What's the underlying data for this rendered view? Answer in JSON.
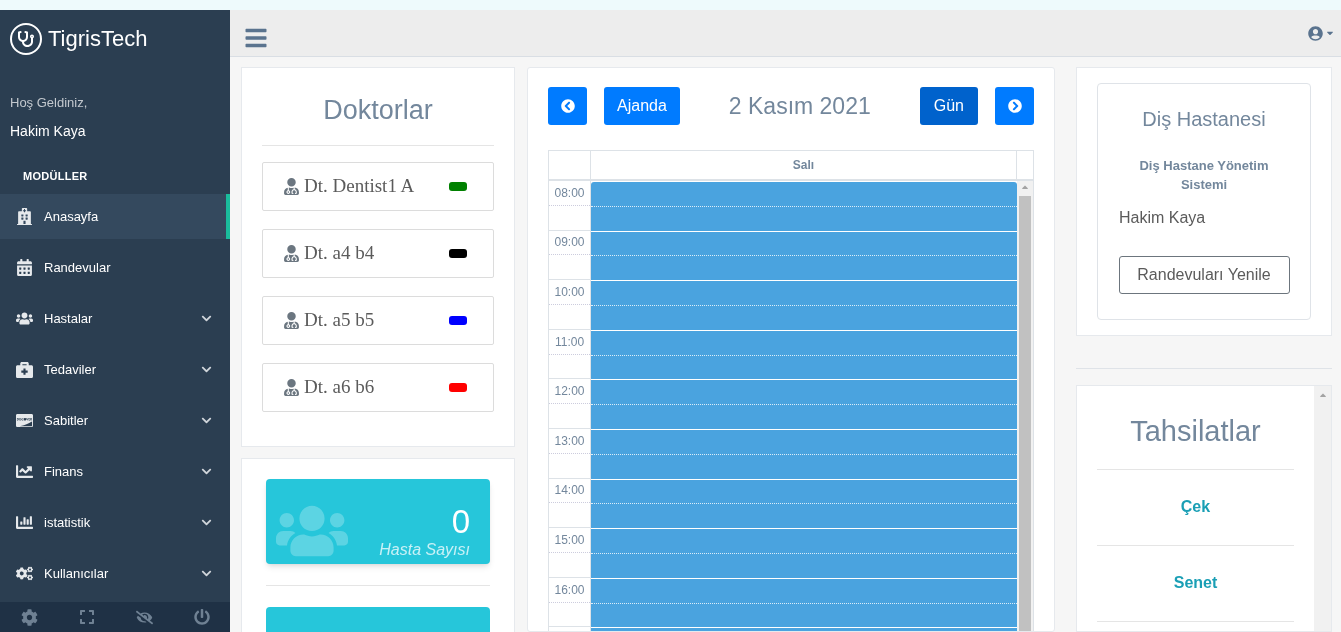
{
  "sidebar": {
    "brand": "TigrisTech",
    "greeting": "Hoş Geldiniz,",
    "user": "Hakim Kaya",
    "section_title": "MODÜLLER",
    "items": [
      {
        "label": "Anasayfa",
        "selected": true,
        "expandable": false
      },
      {
        "label": "Randevular",
        "selected": false,
        "expandable": false
      },
      {
        "label": "Hastalar",
        "selected": false,
        "expandable": true
      },
      {
        "label": "Tedaviler",
        "selected": false,
        "expandable": true
      },
      {
        "label": "Sabitler",
        "selected": false,
        "expandable": true
      },
      {
        "label": "Finans",
        "selected": false,
        "expandable": true
      },
      {
        "label": "istatistik",
        "selected": false,
        "expandable": true
      },
      {
        "label": "Kullanıcılar",
        "selected": false,
        "expandable": true
      }
    ]
  },
  "doctors": {
    "title": "Doktorlar",
    "items": [
      {
        "name": "Dt. Dentist1 A",
        "color": "#008000"
      },
      {
        "name": "Dt. a4 b4",
        "color": "#000000"
      },
      {
        "name": "Dt. a5 b5",
        "color": "#0000ff"
      },
      {
        "name": "Dt. a6 b6",
        "color": "#ff0000"
      }
    ]
  },
  "stats": {
    "value": "0",
    "label": "Hasta Sayısı"
  },
  "calendar": {
    "title": "2 Kasım 2021",
    "views": [
      {
        "label": "Ajanda",
        "selected": false
      },
      {
        "label": "Gün",
        "selected": true
      }
    ],
    "day_header": "Salı",
    "times": [
      "08:00",
      "09:00",
      "10:00",
      "11:00",
      "12:00",
      "13:00",
      "14:00",
      "15:00",
      "16:00"
    ]
  },
  "clinic": {
    "title": "Diş Hastanesi",
    "subtitle": "Diş Hastane Yönetim Sistemi",
    "user": "Hakim Kaya",
    "button": "Randevuları Yenile"
  },
  "payments": {
    "title": "Tahsilatlar",
    "items": [
      "Çek",
      "Senet"
    ]
  }
}
